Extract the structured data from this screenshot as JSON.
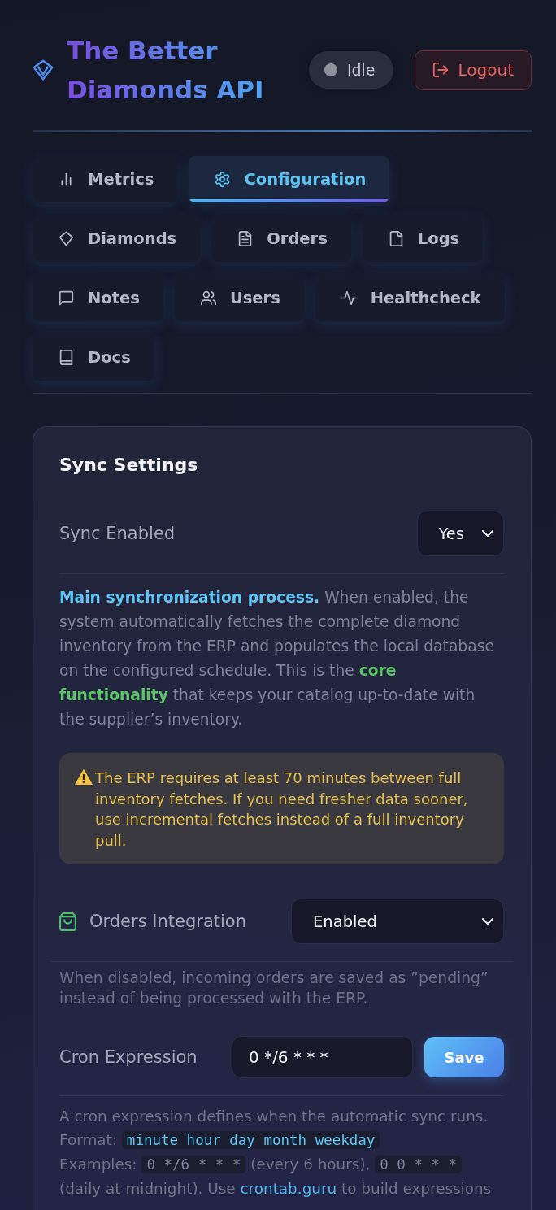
{
  "header": {
    "title": "The Better Diamonds API",
    "status": "Idle",
    "logout_button": "Logout"
  },
  "tabs": [
    {
      "label": "Metrics",
      "selected": false
    },
    {
      "label": "Configuration",
      "selected": true
    },
    {
      "label": "Diamonds",
      "selected": false
    },
    {
      "label": "Orders",
      "selected": false
    },
    {
      "label": "Logs",
      "selected": false
    },
    {
      "label": "Notes",
      "selected": false
    },
    {
      "label": "Users",
      "selected": false
    },
    {
      "label": "Healthcheck",
      "selected": false
    },
    {
      "label": "Docs",
      "selected": false
    }
  ],
  "sync_settings": {
    "title": "Sync Settings",
    "sync_enabled": {
      "label": "Sync Enabled",
      "value": "Yes",
      "description": [
        {
          "kind": "lead",
          "text": "Main synchronization process."
        },
        {
          "kind": "text",
          "text": " When enabled, the system automatically fetches the complete diamond inventory from the ERP and populates the local database on the configured schedule. This is the "
        },
        {
          "kind": "highlight",
          "text": "core functionality"
        },
        {
          "kind": "text",
          "text": " that keeps your catalog up-to-date with the supplier’s inventory."
        }
      ]
    },
    "warning": "The ERP requires at least 70 minutes between full inventory fetches. If you need fresher data sooner, use incremental fetches instead of a full inventory pull.",
    "orders_integration": {
      "label": "Orders Integration",
      "value": "Enabled",
      "help": "When disabled, incoming orders are saved as ”pending” instead of being processed with the ERP."
    },
    "cron": {
      "label": "Cron Expression",
      "value": "0 */6 * * *",
      "button": "Save",
      "help_lines": [
        [
          {
            "kind": "text",
            "text": "A cron expression defines when the automatic sync runs."
          }
        ],
        [
          {
            "kind": "text",
            "text": "Format: "
          },
          {
            "kind": "format",
            "text": "minute hour day month weekday"
          }
        ],
        [
          {
            "kind": "text",
            "text": "Examples: "
          },
          {
            "kind": "example",
            "text": "0 */6 * * *"
          },
          {
            "kind": "text",
            "text": " (every 6 hours), "
          },
          {
            "kind": "example",
            "text": "0 0 * * *"
          },
          {
            "kind": "text",
            "text": " (daily at midnight). Use "
          },
          {
            "kind": "link",
            "text": "crontab.guru"
          },
          {
            "kind": "text",
            "text": " to build expressions"
          }
        ]
      ]
    }
  }
}
